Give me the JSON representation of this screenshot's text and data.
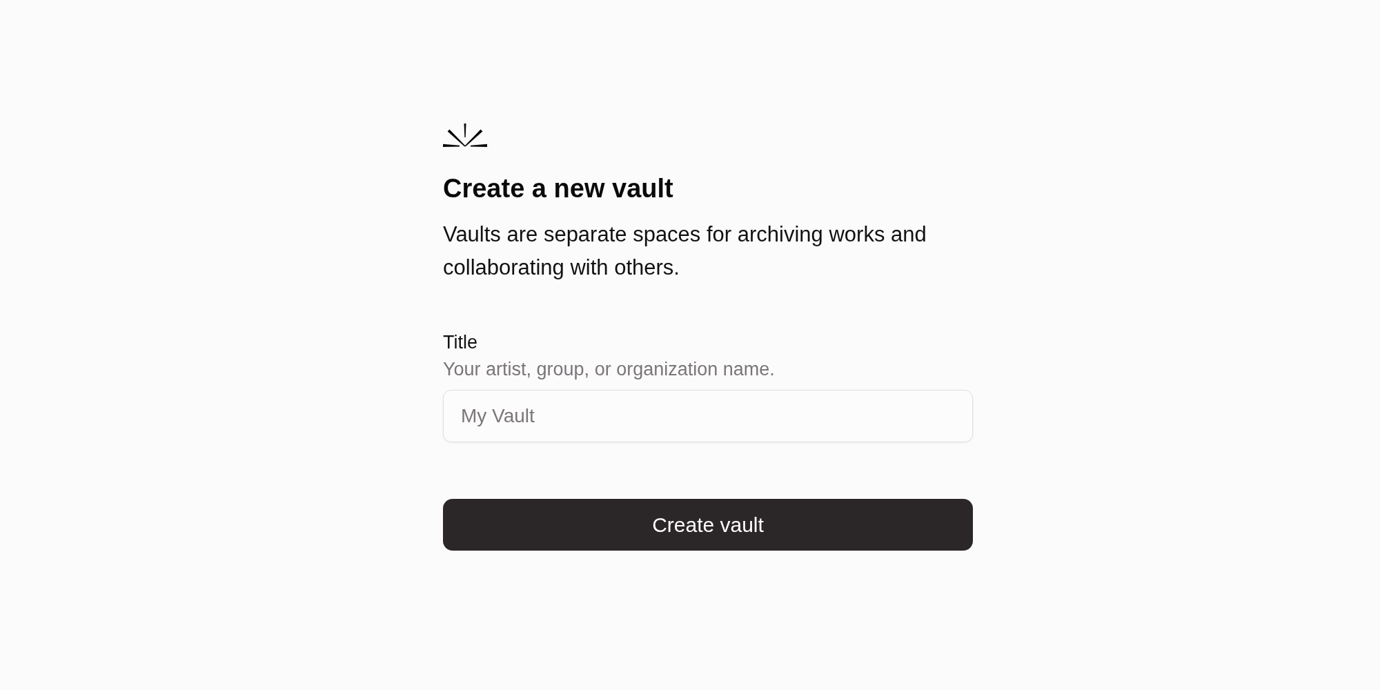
{
  "heading": "Create a new vault",
  "description": "Vaults are separate spaces for archiving works and collaborating with others.",
  "field": {
    "label": "Title",
    "hint": "Your artist, group, or organization name.",
    "placeholder": "My Vault"
  },
  "submit_button": "Create vault"
}
